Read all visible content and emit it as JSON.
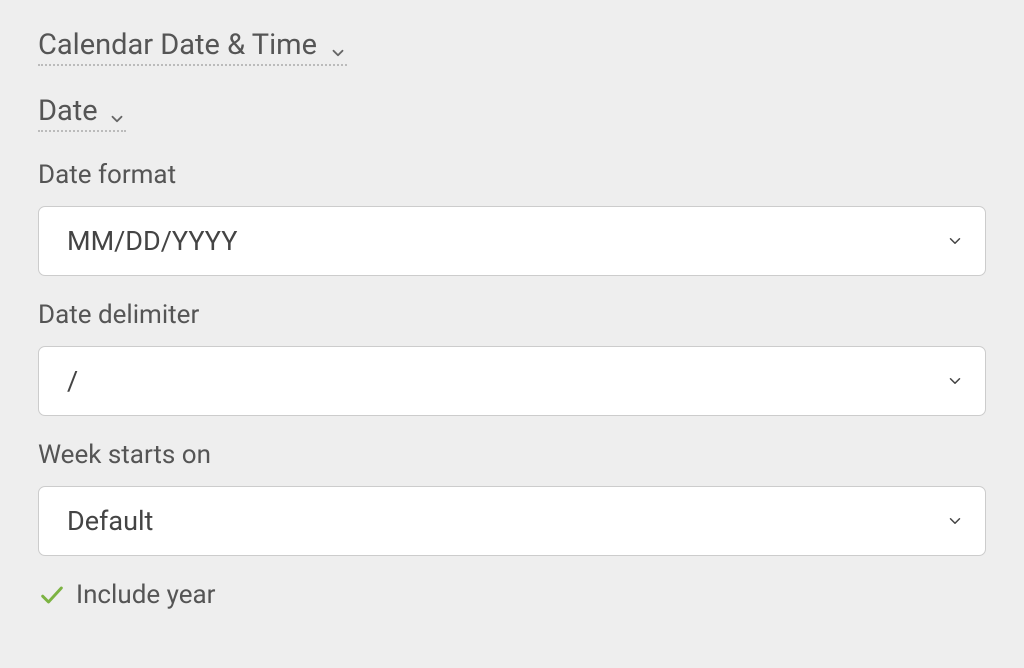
{
  "section": {
    "title": "Calendar Date & Time"
  },
  "subsection": {
    "title": "Date"
  },
  "fields": {
    "dateFormat": {
      "label": "Date format",
      "value": "MM/DD/YYYY"
    },
    "dateDelimiter": {
      "label": "Date delimiter",
      "value": "/"
    },
    "weekStarts": {
      "label": "Week starts on",
      "value": "Default"
    }
  },
  "checkbox": {
    "includeYear": {
      "label": "Include year",
      "checked": true
    }
  }
}
